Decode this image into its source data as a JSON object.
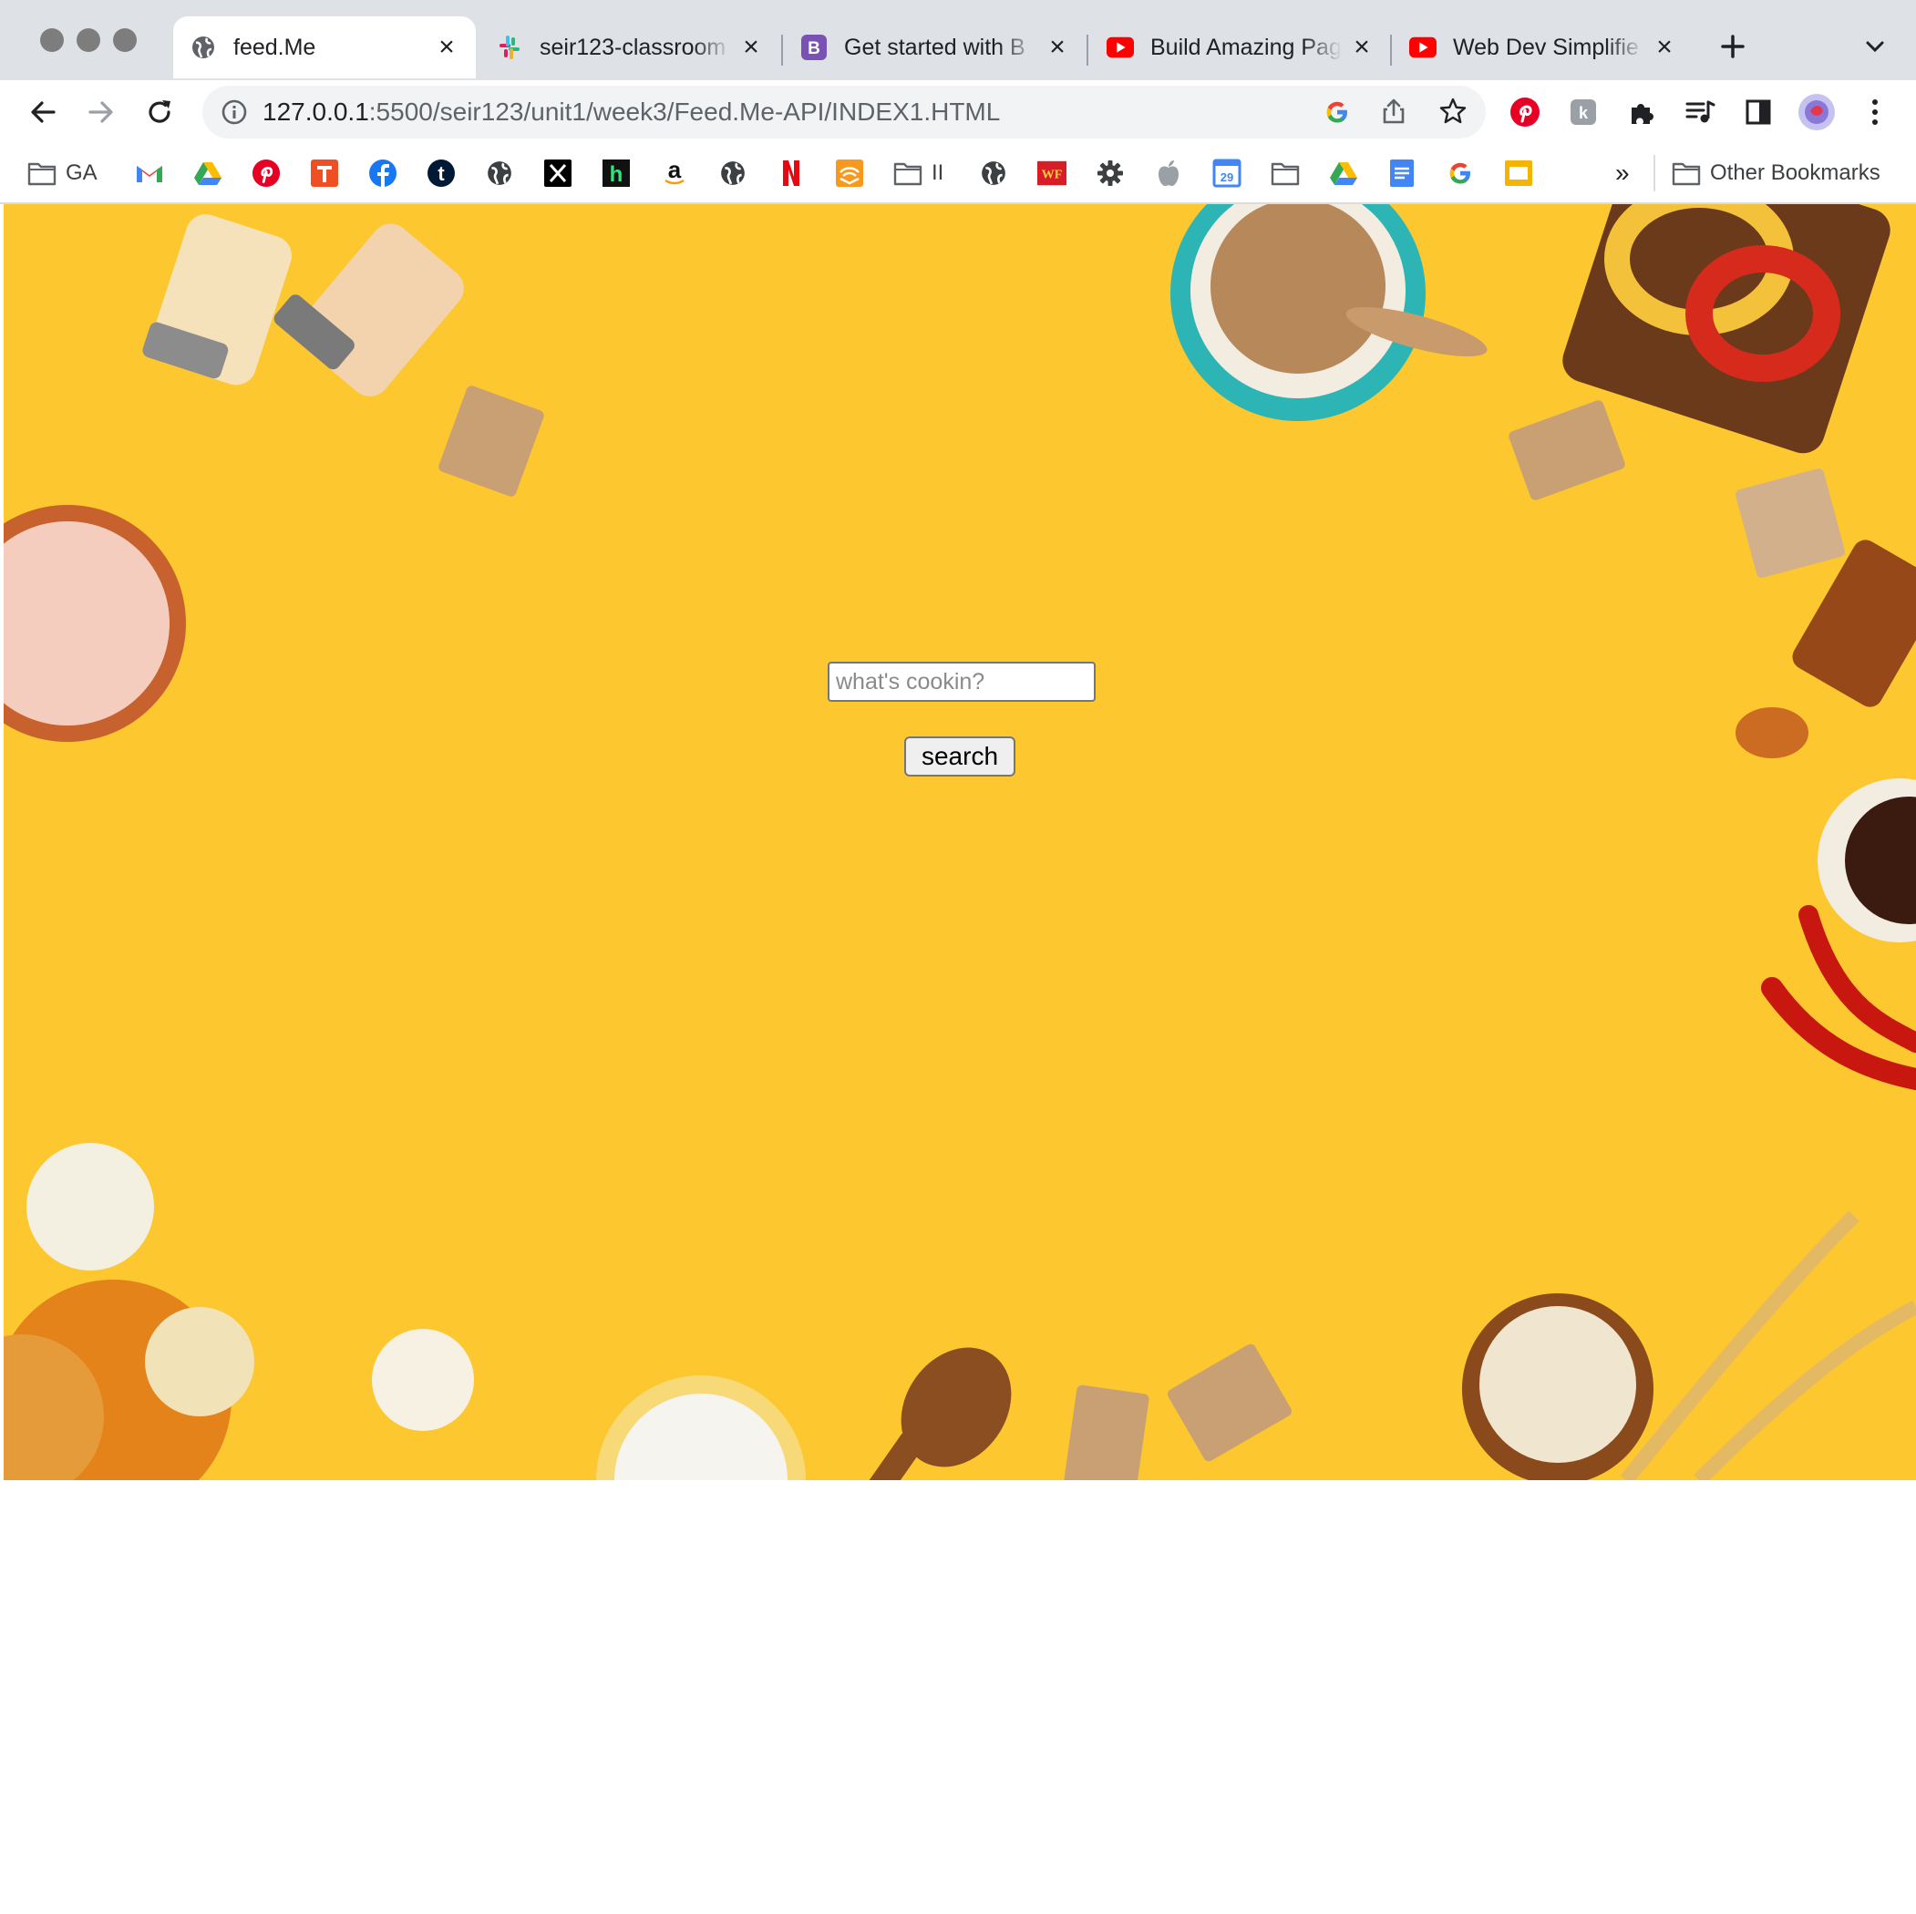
{
  "browser": {
    "tabs": [
      {
        "title": "feed.Me",
        "active": true,
        "icon": "globe-icon"
      },
      {
        "title": "seir123-classroom",
        "active": false,
        "icon": "slack-icon"
      },
      {
        "title": "Get started with B",
        "active": false,
        "icon": "bootstrap-icon"
      },
      {
        "title": "Build Amazing Pag",
        "active": false,
        "icon": "youtube-icon"
      },
      {
        "title": "Web Dev Simplifie",
        "active": false,
        "icon": "youtube-icon"
      }
    ],
    "url_host": "127.0.0.1",
    "url_path": ":5500/seir123/unit1/week3/Feed.Me-API/INDEX1.HTML",
    "bookmarks": {
      "first_folder_label": "GA",
      "second_folder_label": "II",
      "calendar_day": "29",
      "more_label": "»",
      "other_label": "Other Bookmarks"
    }
  },
  "page": {
    "search_placeholder": "what's cookin?",
    "search_button_label": "search",
    "background_color": "#fcc72f"
  }
}
